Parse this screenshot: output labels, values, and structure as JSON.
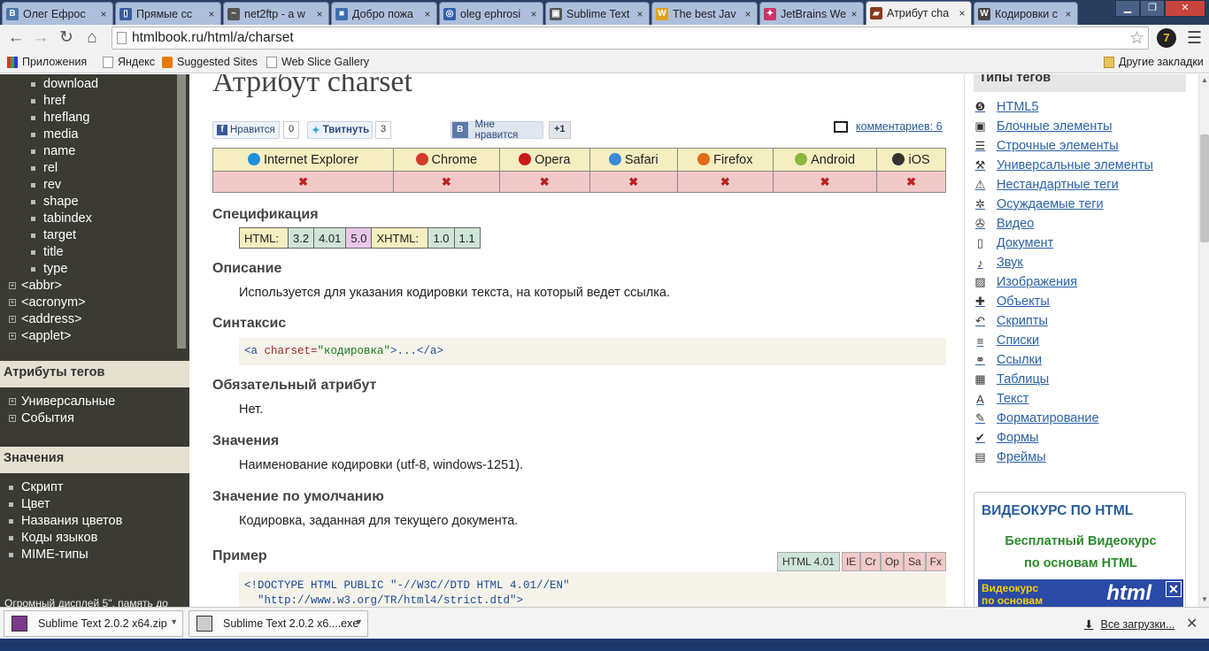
{
  "tabs": [
    {
      "label": "Олег Ефрос",
      "icon": "vk-icon",
      "color": "#4a76a8",
      "glyph": "B"
    },
    {
      "label": "Прямые сс",
      "icon": "page-icon",
      "color": "#3a5a9a",
      "glyph": "▯"
    },
    {
      "label": "net2ftp - a w",
      "icon": "net2ftp-icon",
      "color": "#555555",
      "glyph": "~"
    },
    {
      "label": "Добро пожа",
      "icon": "site-icon",
      "color": "#3b6fb0",
      "glyph": "■"
    },
    {
      "label": "oleg ephrosi",
      "icon": "search-icon",
      "color": "#3060b0",
      "glyph": "◎"
    },
    {
      "label": "Sublime Text",
      "icon": "sublime-icon",
      "color": "#555555",
      "glyph": "▣"
    },
    {
      "label": "The best Jav",
      "icon": "w-icon",
      "color": "#e0a020",
      "glyph": "W"
    },
    {
      "label": "JetBrains We",
      "icon": "jetbrains-icon",
      "color": "#cc3366",
      "glyph": "✦"
    },
    {
      "label": "Атрибут cha",
      "icon": "htmlbook-icon",
      "color": "#8a3a1a",
      "glyph": "▰",
      "active": true
    },
    {
      "label": "Кодировки с",
      "icon": "wikipedia-icon",
      "color": "#444444",
      "glyph": "W"
    }
  ],
  "address": "htmlbook.ru/html/a/charset",
  "bookmarks": [
    {
      "label": "Приложения",
      "icon": "apps-icon"
    },
    {
      "label": "Яндекс",
      "icon": "page-icon"
    },
    {
      "label": "Suggested Sites",
      "icon": "suggested-icon"
    },
    {
      "label": "Web Slice Gallery",
      "icon": "page-icon"
    },
    {
      "label": "Другие закладки",
      "icon": "folder-icon"
    }
  ],
  "sidebar": {
    "subitems": [
      "download",
      "href",
      "hreflang",
      "media",
      "name",
      "rel",
      "rev",
      "shape",
      "tabindex",
      "target",
      "title",
      "type"
    ],
    "tags": [
      "<abbr>",
      "<acronym>",
      "<address>",
      "<applet>"
    ],
    "section_attrs": "Атрибуты тегов",
    "attrs": [
      "Универсальные",
      "События"
    ],
    "section_values": "Значения",
    "values": [
      "Скрипт",
      "Цвет",
      "Названия цветов",
      "Коды языков",
      "MIME-типы"
    ],
    "caption": "Огромный дисплей 5\", память до"
  },
  "main": {
    "title": "Атрибут charset",
    "social": {
      "fb_label": "Нравится",
      "fb_count": "0",
      "tw_label": "Твитнуть",
      "tw_count": "3",
      "vk_label": "Мне нравится",
      "vk_count": "+1"
    },
    "comments": "комментариев: 6",
    "browsers": [
      {
        "name": "Internet Explorer",
        "icon": "ie-icon",
        "color": "#1e90d8"
      },
      {
        "name": "Chrome",
        "icon": "chrome-icon",
        "color": "#d23b2c"
      },
      {
        "name": "Opera",
        "icon": "opera-icon",
        "color": "#cc1b1b"
      },
      {
        "name": "Safari",
        "icon": "safari-icon",
        "color": "#3a8ad8"
      },
      {
        "name": "Firefox",
        "icon": "firefox-icon",
        "color": "#e06a1a"
      },
      {
        "name": "Android",
        "icon": "android-icon",
        "color": "#8ab83a"
      },
      {
        "name": "iOS",
        "icon": "apple-icon",
        "color": "#333333"
      }
    ],
    "support_mark": "✖",
    "h_spec": "Спецификация",
    "spec": {
      "html_label": "HTML:",
      "html_versions": [
        "3.2",
        "4.01",
        "5.0"
      ],
      "xhtml_label": "XHTML:",
      "xhtml_versions": [
        "1.0",
        "1.1"
      ]
    },
    "h_desc": "Описание",
    "desc": "Используется для указания кодировки текста, на который ведет ссылка.",
    "h_syntax": "Синтаксис",
    "syntax": {
      "open": "<a ",
      "attr": "charset=",
      "value": "\"кодировка\"",
      "close": ">...</a>"
    },
    "h_required": "Обязательный атрибут",
    "required": "Нет.",
    "h_values": "Значения",
    "values": "Наименование кодировки (utf-8, windows-1251).",
    "h_default": "Значение по умолчанию",
    "default": "Кодировка, заданная для текущего документа.",
    "h_example": "Пример",
    "example_badges": [
      "HTML 4.01",
      "IE",
      "Cr",
      "Op",
      "Sa",
      "Fx"
    ],
    "example_line1": "<!DOCTYPE HTML PUBLIC \"-//W3C//DTD HTML 4.01//EN\"",
    "example_line2": "  \"http://www.w3.org/TR/html4/strict.dtd\">"
  },
  "right": {
    "head": "Типы тегов",
    "items": [
      {
        "label": "HTML5",
        "icon": "html5-icon",
        "glyph": "❺"
      },
      {
        "label": "Блочные элементы",
        "icon": "cube-icon",
        "glyph": "▣"
      },
      {
        "label": "Строчные элементы",
        "icon": "lines-icon",
        "glyph": "☰"
      },
      {
        "label": "Универсальные элементы",
        "icon": "tools-icon",
        "glyph": "⚒"
      },
      {
        "label": "Нестандартные теги",
        "icon": "warning-icon",
        "glyph": "⚠"
      },
      {
        "label": "Осуждаемые теги",
        "icon": "bug-icon",
        "glyph": "✲"
      },
      {
        "label": "Видео",
        "icon": "film-icon",
        "glyph": "✇"
      },
      {
        "label": "Документ",
        "icon": "document-icon",
        "glyph": "▯"
      },
      {
        "label": "Звук",
        "icon": "sound-icon",
        "glyph": "♪"
      },
      {
        "label": "Изображения",
        "icon": "image-icon",
        "glyph": "▨"
      },
      {
        "label": "Объекты",
        "icon": "puzzle-icon",
        "glyph": "✚"
      },
      {
        "label": "Скрипты",
        "icon": "script-icon",
        "glyph": "↶"
      },
      {
        "label": "Списки",
        "icon": "list-icon",
        "glyph": "≡"
      },
      {
        "label": "Ссылки",
        "icon": "link-icon",
        "glyph": "⚭"
      },
      {
        "label": "Таблицы",
        "icon": "table-icon",
        "glyph": "▦"
      },
      {
        "label": "Текст",
        "icon": "text-icon",
        "glyph": "A"
      },
      {
        "label": "Форматирование",
        "icon": "brush-icon",
        "glyph": "✎"
      },
      {
        "label": "Формы",
        "icon": "check-icon",
        "glyph": "✔"
      },
      {
        "label": "Фреймы",
        "icon": "frame-icon",
        "glyph": "▤"
      }
    ],
    "video_title": "ВИДЕОКУРС ПО HTML",
    "video_line1": "Бесплатный Видеокурс",
    "video_line2": "по основам HTML",
    "banner_text1": "Видеокурс",
    "banner_text2": "по основам",
    "banner_big": "html"
  },
  "downloads": {
    "items": [
      "Sublime Text 2.0.2 x64.zip",
      "Sublime Text 2.0.2 x6....exe"
    ],
    "all": "Все загрузки..."
  }
}
